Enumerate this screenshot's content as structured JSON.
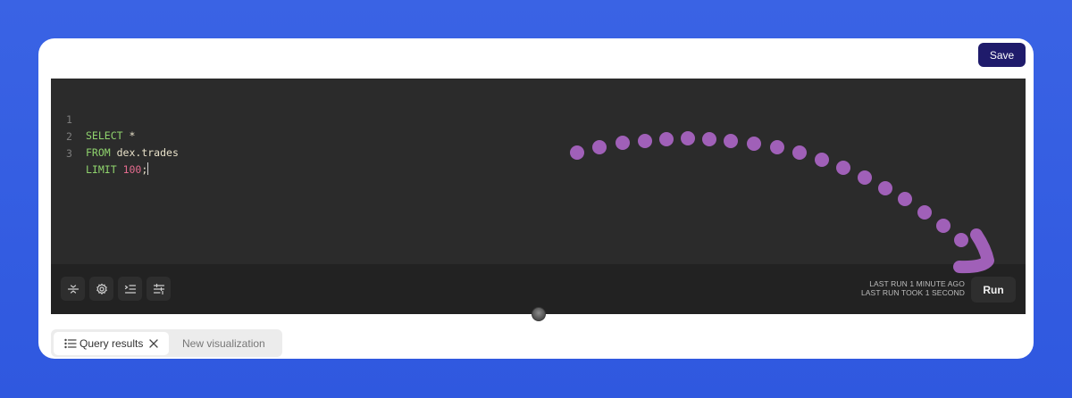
{
  "toolbar": {
    "save_label": "Save"
  },
  "editor": {
    "lines": [
      {
        "number": "1",
        "keyword": "SELECT",
        "rest": " *",
        "num": "",
        "tail": ""
      },
      {
        "number": "2",
        "keyword": "FROM",
        "rest": " dex.trades",
        "num": "",
        "tail": ""
      },
      {
        "number": "3",
        "keyword": "LIMIT",
        "rest": " ",
        "num": "100",
        "tail": ";"
      }
    ]
  },
  "bottom_bar": {
    "icons": [
      "collapse-icon",
      "settings-icon",
      "format-icon",
      "params-icon"
    ],
    "status_line1": "LAST RUN 1 MINUTE AGO",
    "status_line2": "LAST RUN TOOK 1 SECOND",
    "run_label": "Run"
  },
  "tabs": {
    "active": "Query results",
    "inactive": "New visualization"
  },
  "annotation": {
    "color": "#a060b8"
  }
}
